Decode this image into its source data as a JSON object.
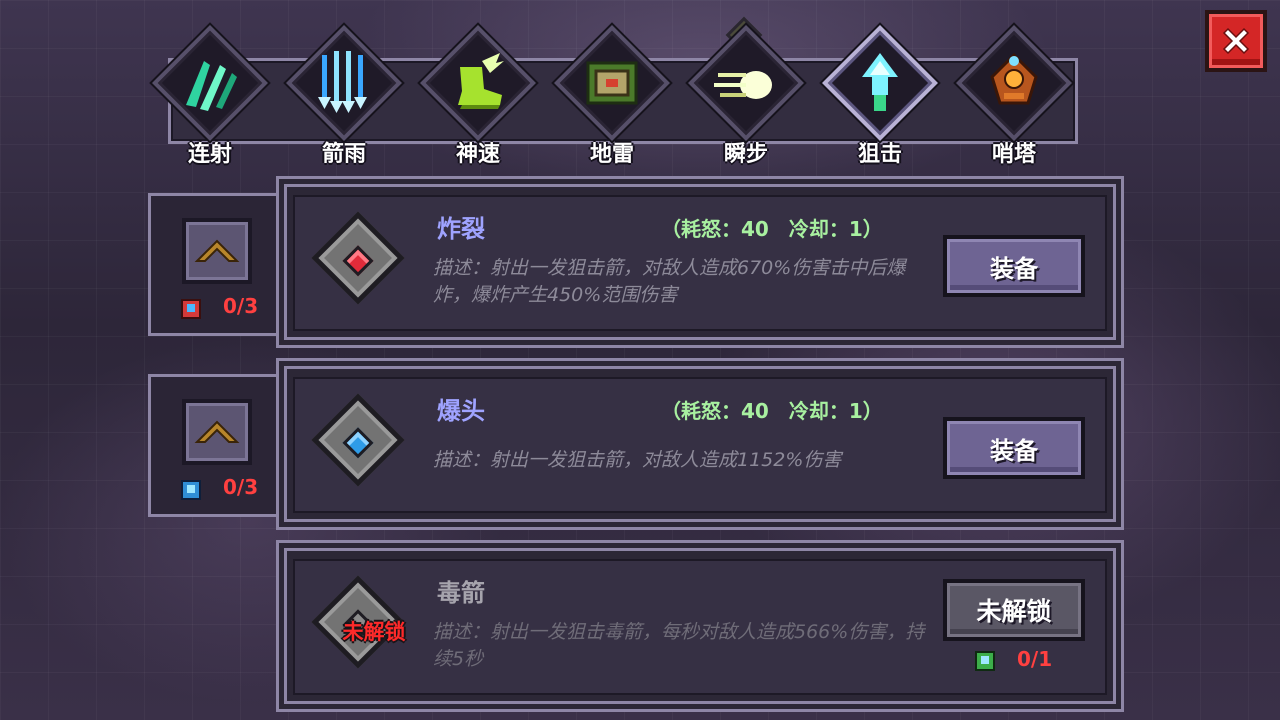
{
  "tabs": [
    {
      "label": "连射",
      "icon": "multishot-icon"
    },
    {
      "label": "箭雨",
      "icon": "arrow-rain-icon"
    },
    {
      "label": "神速",
      "icon": "speed-boot-icon"
    },
    {
      "label": "地雷",
      "icon": "landmine-icon"
    },
    {
      "label": "瞬步",
      "icon": "blink-step-icon"
    },
    {
      "label": "狙击",
      "icon": "snipe-icon"
    },
    {
      "label": "哨塔",
      "icon": "sentry-tower-icon"
    }
  ],
  "selected_tab": "狙击",
  "skills": [
    {
      "name": "炸裂",
      "stats": "（耗怒：40　冷却：1）",
      "description": "描述：射出一发狙击箭，对敌人造成670%伤害击中后爆炸，爆炸产生450%范围伤害",
      "gem": "red-gem-icon",
      "button": "装备",
      "upgrade_cost": "0/3",
      "upgrade_book": "red-skill-book-icon"
    },
    {
      "name": "爆头",
      "stats": "（耗怒：40　冷却：1）",
      "description": "描述：射出一发狙击箭，对敌人造成1152%伤害",
      "gem": "blue-gem-icon",
      "button": "装备",
      "upgrade_cost": "0/3",
      "upgrade_book": "blue-skill-book-icon"
    },
    {
      "name": "毒箭",
      "locked_tag": "未解锁",
      "description": "描述：射出一发狙击毒箭，每秒对敌人造成566%伤害，持续5秒",
      "gem": "grey-gem-icon",
      "button": "未解锁",
      "unlock_cost": "0/1",
      "unlock_book": "green-skill-book-icon"
    }
  ],
  "colors": {
    "skill_name": "#9fa3ff",
    "stats": "#a8f0a0",
    "cost_text": "#ff4040",
    "button": "#6e6493",
    "close_button": "#d42626"
  }
}
